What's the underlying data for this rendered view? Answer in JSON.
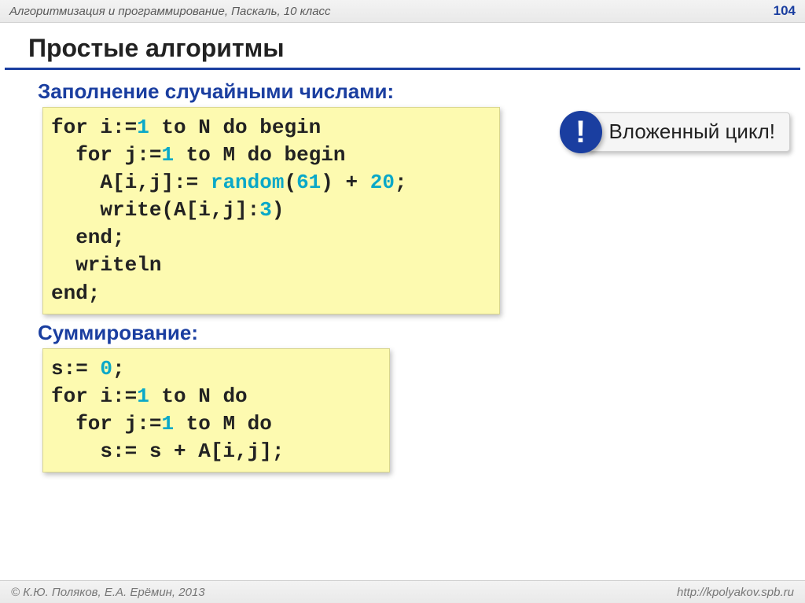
{
  "header": {
    "breadcrumb": "Алгоритмизация и программирование, Паскаль, 10 класс",
    "page_number": "104"
  },
  "title": "Простые алгоритмы",
  "section1": {
    "heading": "Заполнение случайными числами:",
    "callout_bang": "!",
    "callout_text": "Вложенный цикл!"
  },
  "section2": {
    "heading": "Суммирование:"
  },
  "code1": {
    "l1a": "for i:=",
    "l1n": "1",
    "l1b": " to N do begin",
    "l2a": "  for j:=",
    "l2n": "1",
    "l2b": " to M do begin",
    "l3a": "    A[i,j]:= ",
    "l3call": "random",
    "l3b": "(",
    "l3n1": "61",
    "l3c": ") + ",
    "l3n2": "20",
    "l3d": ";",
    "l4a": "    write(A[i,j]:",
    "l4n": "3",
    "l4b": ")",
    "l5": "  end;",
    "l6": "  writeln",
    "l7": "end;"
  },
  "code2": {
    "l1a": "s:= ",
    "l1n": "0",
    "l1b": ";",
    "l2a": "for i:=",
    "l2n": "1",
    "l2b": " to N do",
    "l3a": "  for j:=",
    "l3n": "1",
    "l3b": " to M do",
    "l4": "    s:= s + A[i,j];"
  },
  "footer": {
    "left": "© К.Ю. Поляков, Е.А. Ерёмин, 2013",
    "right": "http://kpolyakov.spb.ru"
  }
}
